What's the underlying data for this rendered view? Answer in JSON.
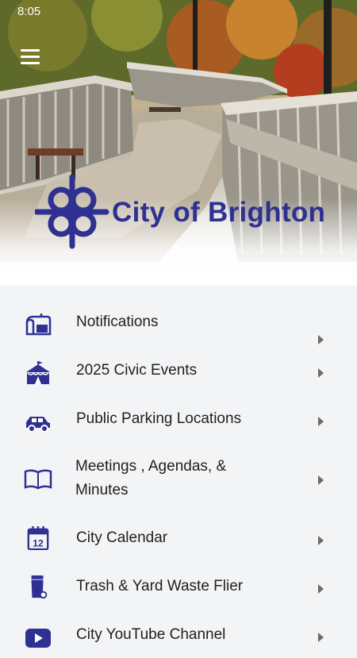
{
  "status_bar": {
    "time": "8:05"
  },
  "header": {
    "brand_name": "City of Brighton",
    "brand_color": "#2e3192"
  },
  "menu": {
    "items": [
      {
        "label_lines": [
          "Notifications"
        ],
        "icon": "mailbox-icon"
      },
      {
        "label_lines": [
          "2025 Civic Events"
        ],
        "icon": "circus-tent-icon"
      },
      {
        "label_lines": [
          "Public Parking Locations"
        ],
        "icon": "car-icon"
      },
      {
        "label_lines": [
          "Meetings , Agendas, &",
          "Minutes"
        ],
        "icon": "book-icon"
      },
      {
        "label_lines": [
          "City Calendar"
        ],
        "icon": "calendar-icon",
        "icon_text": "12"
      },
      {
        "label_lines": [
          "Trash & Yard Waste Flier"
        ],
        "icon": "trash-can-icon"
      },
      {
        "label_lines": [
          "City YouTube Channel"
        ],
        "icon": "youtube-icon"
      }
    ]
  },
  "colors": {
    "icon": "#2e3192",
    "background": "#f3f4f6",
    "chevron": "#6b6b6b"
  }
}
